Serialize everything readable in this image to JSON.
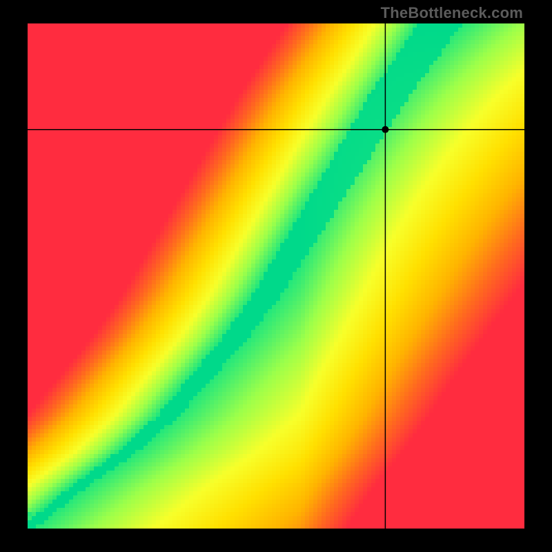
{
  "watermark": "TheBottleneck.com",
  "chart_data": {
    "type": "heatmap",
    "title": "",
    "xlabel": "",
    "ylabel": "",
    "xlim": [
      0,
      1
    ],
    "ylim": [
      0,
      1
    ],
    "crosshair": {
      "x": 0.72,
      "y": 0.79
    },
    "colormap": [
      "#ff2c3f",
      "#ff6a1e",
      "#ffb400",
      "#ffe000",
      "#f7ff2a",
      "#9cff4a",
      "#1de67e",
      "#00d98a"
    ],
    "optimal_curve": {
      "description": "green optimal ridge: y as function of x (normalized 0..1), S-shaped diagonal",
      "points": [
        [
          0.0,
          0.0
        ],
        [
          0.1,
          0.08
        ],
        [
          0.2,
          0.15
        ],
        [
          0.28,
          0.22
        ],
        [
          0.35,
          0.3
        ],
        [
          0.42,
          0.38
        ],
        [
          0.48,
          0.46
        ],
        [
          0.53,
          0.54
        ],
        [
          0.58,
          0.62
        ],
        [
          0.63,
          0.7
        ],
        [
          0.68,
          0.78
        ],
        [
          0.73,
          0.86
        ],
        [
          0.78,
          0.93
        ],
        [
          0.83,
          1.0
        ]
      ],
      "ridge_width": 0.05
    },
    "field": {
      "description": "value = closeness to optimal ridge; 1 on ridge (green), 0 far (red); asymmetric falloff — right side of ridge warmer (orange/yellow), left side colder (red) faster"
    }
  }
}
